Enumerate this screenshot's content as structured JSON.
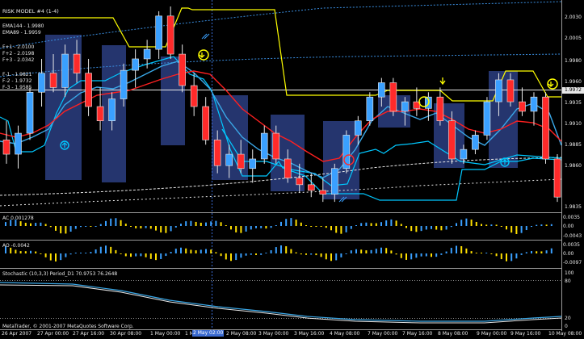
{
  "main_panel": {
    "title": "RISK MODEL #4 (1-4)",
    "ema_labels": [
      "EMA144 - 1.9980",
      "EMA89 - 1.9959"
    ],
    "fib_labels": [
      "F+1 - 2.0100",
      "F+2 - 2.0198",
      "F+3 - 2.0342"
    ],
    "fib_labels_low": [
      "F-1 - 1.9821",
      "F-2 - 1.9732",
      "F-3 - 1.9585"
    ],
    "price_ticks": [
      "2.0030",
      "2.0005",
      "1.9980",
      "1.9960",
      "1.9935",
      "1.9910",
      "1.9885",
      "1.9860",
      "1.9835"
    ],
    "current_price_marker": "1.9972",
    "colors": {
      "bull": "#3aa0ff",
      "bear": "#ff2a2a",
      "shade": "#25356e",
      "ema_fast": "#ff2020",
      "ema_slow": "#3aa8e8",
      "band": "#00c8ff",
      "yellow": "#ffff00"
    }
  },
  "ac_panel": {
    "label": "AC 0.001278",
    "ticks": [
      "0.0035",
      "0.00",
      "-0.0043"
    ]
  },
  "ao_panel": {
    "label": "AO -0.0042",
    "ticks": [
      "0.0035",
      "0.00",
      "-0.0097"
    ]
  },
  "stoch_panel": {
    "label": "Stochastic (10,3,3) Period_D1 70.9753 76.2648",
    "ticks": [
      "100",
      "80",
      "20",
      "0"
    ],
    "copyright": "MetaTrader, © 2001-2007 MetaQuotes Software Corp."
  },
  "time_axis": {
    "labels": [
      "26 Apr 2007",
      "27 Apr 00:00",
      "27 Apr 16:00",
      "30 Apr 08:00",
      "1 May 00:00",
      "1 May 16:00",
      "2 May 08:00",
      "3 May 00:00",
      "3 May 16:00",
      "4 May 08:00",
      "7 May 00:00",
      "7 May 16:00",
      "8 May 08:00",
      "9 May 00:00",
      "9 May 16:00",
      "10 May 08:00"
    ],
    "highlight": "2 May 02:00"
  },
  "chart_data": {
    "type": "candlestick",
    "title": "RISK MODEL #4 (1-4)",
    "ylim": [
      1.9835,
      2.0045
    ],
    "ohlc": [
      [
        1.9905,
        1.9925,
        1.988,
        1.989
      ],
      [
        1.989,
        1.992,
        1.9875,
        1.9912
      ],
      [
        1.9912,
        1.996,
        1.9905,
        1.9955
      ],
      [
        1.9955,
        1.999,
        1.994,
        1.9975
      ],
      [
        1.9975,
        1.9995,
        1.9955,
        1.996
      ],
      [
        1.996,
        2.0005,
        1.995,
        1.9995
      ],
      [
        1.9995,
        2.001,
        1.9965,
        1.9975
      ],
      [
        1.9975,
        1.999,
        1.993,
        1.994
      ],
      [
        1.994,
        1.996,
        1.9915,
        1.9925
      ],
      [
        1.9925,
        1.9955,
        1.9915,
        1.9948
      ],
      [
        1.9948,
        1.9985,
        1.994,
        1.9978
      ],
      [
        1.9978,
        2.0,
        1.996,
        1.999
      ],
      [
        1.999,
        2.001,
        1.998,
        2.0
      ],
      [
        2.0,
        2.004,
        1.999,
        2.0035
      ],
      [
        2.0035,
        2.0045,
        1.999,
        1.9995
      ],
      [
        1.9995,
        2.0005,
        1.9955,
        1.9962
      ],
      [
        1.9962,
        1.9975,
        1.993,
        1.994
      ],
      [
        1.994,
        1.995,
        1.99,
        1.9905
      ],
      [
        1.9905,
        1.9915,
        1.987,
        1.9878
      ],
      [
        1.9878,
        1.99,
        1.9865,
        1.989
      ],
      [
        1.989,
        1.9905,
        1.987,
        1.9875
      ],
      [
        1.9875,
        1.9895,
        1.986,
        1.9885
      ],
      [
        1.9885,
        1.992,
        1.988,
        1.9912
      ],
      [
        1.9912,
        1.992,
        1.988,
        1.9885
      ],
      [
        1.9885,
        1.9895,
        1.986,
        1.9865
      ],
      [
        1.9865,
        1.988,
        1.985,
        1.9858
      ],
      [
        1.9858,
        1.987,
        1.9845,
        1.9852
      ],
      [
        1.9852,
        1.9865,
        1.984,
        1.9848
      ],
      [
        1.9848,
        1.988,
        1.984,
        1.9875
      ],
      [
        1.9875,
        1.9915,
        1.987,
        1.991
      ],
      [
        1.991,
        1.993,
        1.99,
        1.9925
      ],
      [
        1.9925,
        1.9955,
        1.992,
        1.995
      ],
      [
        1.995,
        1.997,
        1.994,
        1.9965
      ],
      [
        1.9965,
        1.997,
        1.993,
        1.9935
      ],
      [
        1.9935,
        1.995,
        1.992,
        1.9945
      ],
      [
        1.9945,
        1.996,
        1.993,
        1.9938
      ],
      [
        1.9938,
        1.9955,
        1.9925,
        1.995
      ],
      [
        1.995,
        1.996,
        1.992,
        1.9925
      ],
      [
        1.9925,
        1.9935,
        1.988,
        1.9885
      ],
      [
        1.9885,
        1.99,
        1.988,
        1.9895
      ],
      [
        1.9895,
        1.9915,
        1.989,
        1.991
      ],
      [
        1.991,
        1.995,
        1.9905,
        1.9945
      ],
      [
        1.9945,
        1.9975,
        1.993,
        1.9968
      ],
      [
        1.9968,
        1.9975,
        1.994,
        1.9945
      ],
      [
        1.9945,
        1.996,
        1.993,
        1.9935
      ],
      [
        1.9935,
        1.9955,
        1.992,
        1.995
      ],
      [
        1.995,
        1.9955,
        1.988,
        1.9885
      ],
      [
        1.9885,
        1.989,
        1.984,
        1.9845
      ]
    ]
  }
}
